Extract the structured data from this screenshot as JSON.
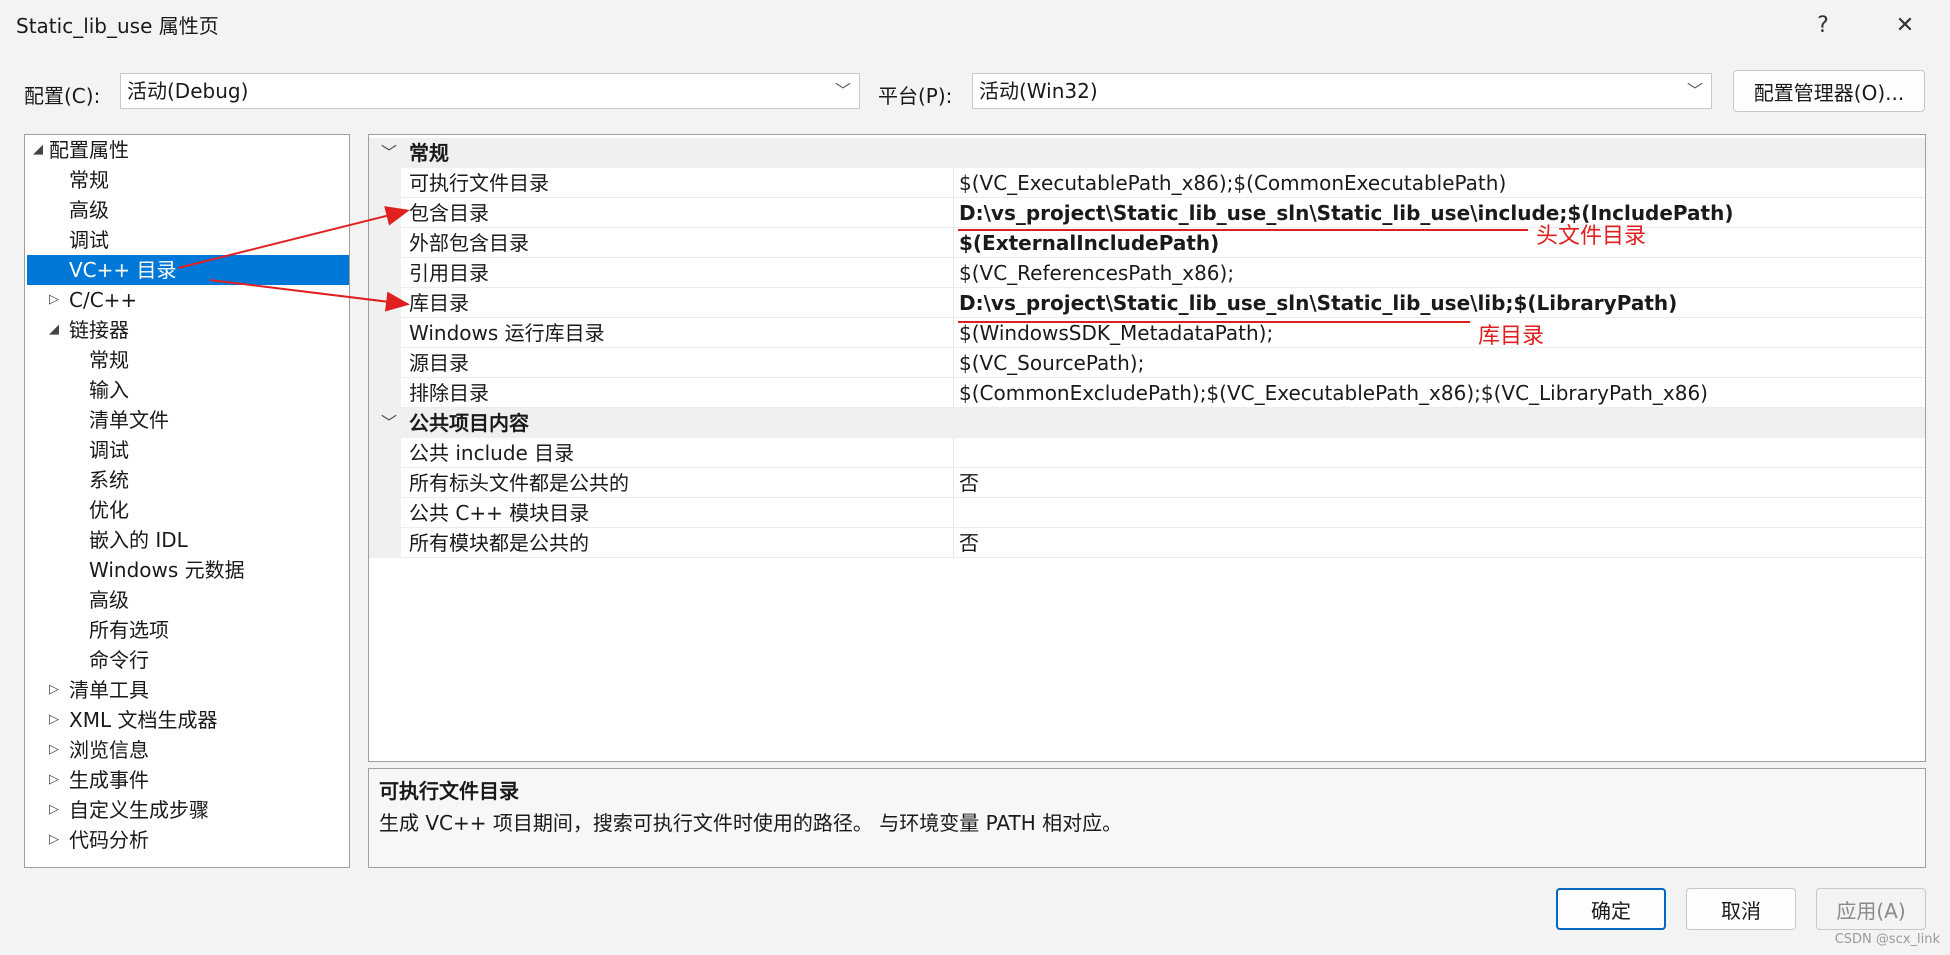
{
  "window": {
    "title": "Static_lib_use 属性页",
    "help_label": "?",
    "close_label": "✕"
  },
  "toolbar": {
    "config_label": "配置(C):",
    "config_value": "活动(Debug)",
    "platform_label": "平台(P):",
    "platform_value": "活动(Win32)",
    "config_manager_label": "配置管理器(O)..."
  },
  "tree": {
    "items": [
      {
        "label": "配置属性",
        "arrow": "◢"
      },
      {
        "label": "常规"
      },
      {
        "label": "高级"
      },
      {
        "label": "调试"
      },
      {
        "label": "VC++ 目录",
        "selected": true
      },
      {
        "label": "C/C++",
        "arrow": "▷"
      },
      {
        "label": "链接器",
        "arrow": "◢"
      },
      {
        "label": "常规"
      },
      {
        "label": "输入"
      },
      {
        "label": "清单文件"
      },
      {
        "label": "调试"
      },
      {
        "label": "系统"
      },
      {
        "label": "优化"
      },
      {
        "label": "嵌入的 IDL"
      },
      {
        "label": "Windows 元数据"
      },
      {
        "label": "高级"
      },
      {
        "label": "所有选项"
      },
      {
        "label": "命令行"
      },
      {
        "label": "清单工具",
        "arrow": "▷"
      },
      {
        "label": "XML 文档生成器",
        "arrow": "▷"
      },
      {
        "label": "浏览信息",
        "arrow": "▷"
      },
      {
        "label": "生成事件",
        "arrow": "▷"
      },
      {
        "label": "自定义生成步骤",
        "arrow": "▷"
      },
      {
        "label": "代码分析",
        "arrow": "▷"
      }
    ]
  },
  "grid": {
    "sections": [
      {
        "title": "常规",
        "rows": [
          {
            "name": "可执行文件目录",
            "value": "$(VC_ExecutablePath_x86);$(CommonExecutablePath)"
          },
          {
            "name": "包含目录",
            "value": "D:\\vs_project\\Static_lib_use_sln\\Static_lib_use\\include;$(IncludePath)",
            "bold": true
          },
          {
            "name": "外部包含目录",
            "value": "$(ExternalIncludePath)",
            "bold": true
          },
          {
            "name": "引用目录",
            "value": "$(VC_ReferencesPath_x86);"
          },
          {
            "name": "库目录",
            "value": "D:\\vs_project\\Static_lib_use_sln\\Static_lib_use\\lib;$(LibraryPath)",
            "bold": true
          },
          {
            "name": "Windows 运行库目录",
            "value": "$(WindowsSDK_MetadataPath);"
          },
          {
            "name": "源目录",
            "value": "$(VC_SourcePath);"
          },
          {
            "name": "排除目录",
            "value": "$(CommonExcludePath);$(VC_ExecutablePath_x86);$(VC_LibraryPath_x86)"
          }
        ]
      },
      {
        "title": "公共项目内容",
        "rows": [
          {
            "name": "公共 include 目录",
            "value": ""
          },
          {
            "name": "所有标头文件都是公共的",
            "value": "否"
          },
          {
            "name": "公共 C++ 模块目录",
            "value": ""
          },
          {
            "name": "所有模块都是公共的",
            "value": "否"
          }
        ]
      }
    ]
  },
  "description": {
    "title": "可执行文件目录",
    "text": "生成 VC++ 项目期间，搜索可执行文件时使用的路径。 与环境变量 PATH 相对应。"
  },
  "buttons": {
    "ok": "确定",
    "cancel": "取消",
    "apply": "应用(A)"
  },
  "annotations": {
    "include_note": "头文件目录",
    "lib_note": "库目录",
    "color": "#e02020"
  },
  "watermark": "CSDN @scx_link",
  "colors": {
    "selection": "#0078d7",
    "accent_border": "#0067c0"
  }
}
